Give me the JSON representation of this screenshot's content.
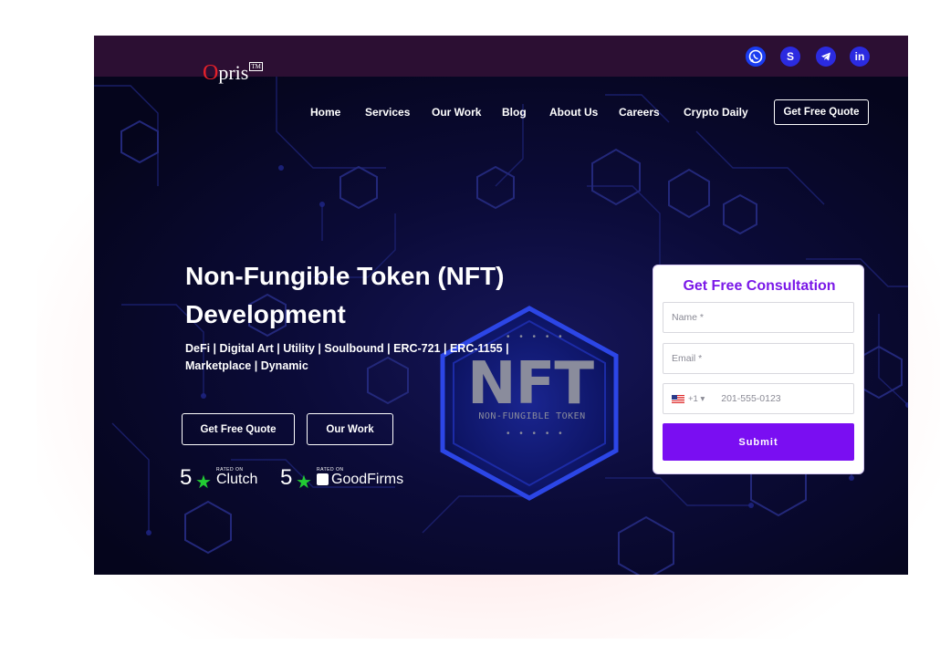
{
  "social": {
    "whatsapp_icon": "whatsapp-icon",
    "skype_label": "S",
    "telegram_icon": "telegram-icon",
    "linkedin_label": "in"
  },
  "logo": {
    "first": "O",
    "rest": "pris",
    "tm": "TM"
  },
  "nav": {
    "items": [
      "Home",
      "Services",
      "Our Work",
      "Blog",
      "About Us",
      "Careers",
      "Crypto Daily"
    ],
    "cta": "Get Free Quote"
  },
  "hero": {
    "title_line1": "Non-Fungible Token (NFT)",
    "title_line2": "Development",
    "subtitle_line1": "DeFi | Digital Art | Utility | Soulbound | ERC-721 | ERC-1155 |",
    "subtitle_line2": "Marketplace | Dynamic",
    "btn_quote": "Get Free Quote",
    "btn_work": "Our Work"
  },
  "ratings": [
    {
      "score": "5",
      "rated": "RATED ON",
      "platform": "Clutch"
    },
    {
      "score": "5",
      "rated": "RATED ON",
      "platform": "GoodFirms"
    }
  ],
  "nft_badge": {
    "big": "NFT",
    "small": "NON-FUNGIBLE TOKEN",
    "dots": "• • • • •"
  },
  "form": {
    "title": "Get Free Consultation",
    "name_placeholder": "Name *",
    "email_placeholder": "Email *",
    "country_code": "+1 ▾",
    "phone_placeholder": "201-555-0123",
    "submit": "Submit"
  },
  "colors": {
    "topbar": "#2c0f33",
    "accent_purple": "#7a0ef2",
    "social_blue": "#2b2be0",
    "star_green": "#22cc33"
  }
}
